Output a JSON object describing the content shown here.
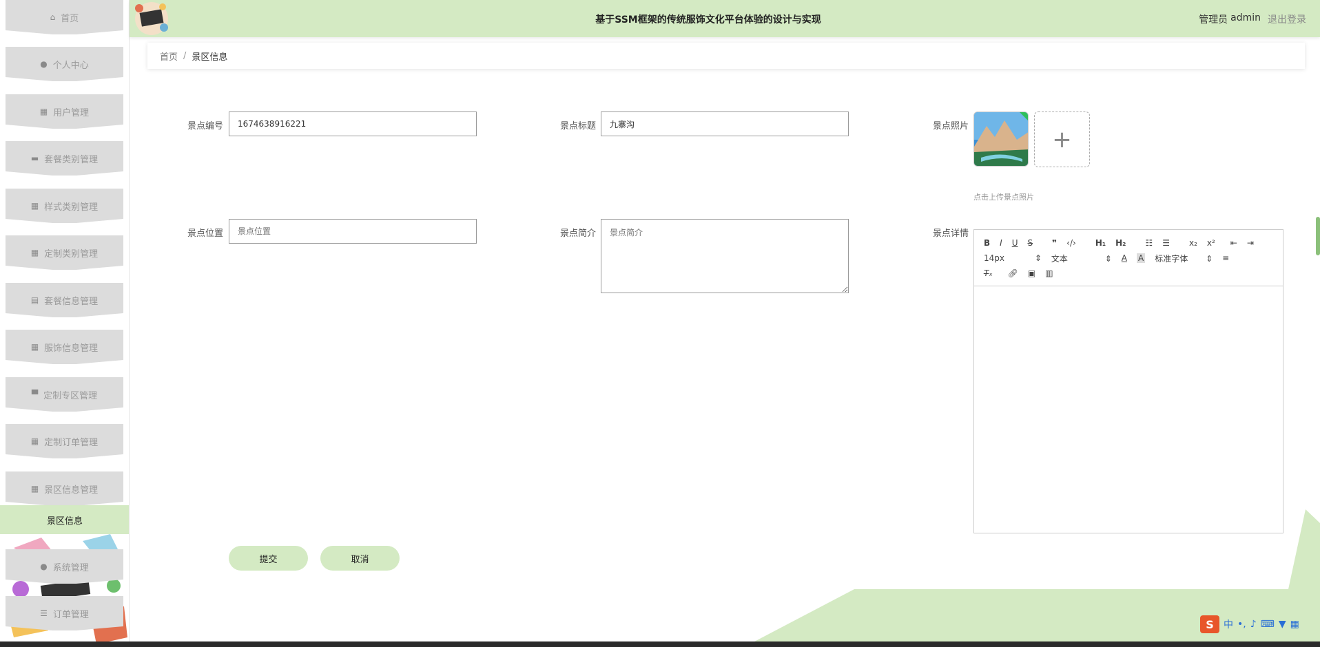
{
  "header": {
    "title": "基于SSM框架的传统服饰文化平台体验的设计与实现",
    "user_role": "管理员",
    "user_name": "admin",
    "logout": "退出登录"
  },
  "sidebar": {
    "items": [
      {
        "label": "首页",
        "icon": "home-icon"
      },
      {
        "label": "个人中心",
        "icon": "user-icon"
      },
      {
        "label": "用户管理",
        "icon": "grid-icon"
      },
      {
        "label": "套餐类别管理",
        "icon": "briefcase-icon"
      },
      {
        "label": "样式类别管理",
        "icon": "grid-icon"
      },
      {
        "label": "定制类别管理",
        "icon": "grid-icon"
      },
      {
        "label": "套餐信息管理",
        "icon": "clipboard-icon"
      },
      {
        "label": "服饰信息管理",
        "icon": "grid-icon"
      },
      {
        "label": "定制专区管理",
        "icon": "monitor-icon"
      },
      {
        "label": "定制订单管理",
        "icon": "grid-icon"
      },
      {
        "label": "景区信息管理",
        "icon": "grid-icon"
      }
    ],
    "active": "景区信息",
    "bottom_items": [
      {
        "label": "系统管理",
        "icon": "pin-icon"
      },
      {
        "label": "订单管理",
        "icon": "list-icon"
      }
    ]
  },
  "breadcrumb": {
    "home": "首页",
    "separator": "/",
    "current": "景区信息"
  },
  "form": {
    "code_label": "景点编号",
    "code_value": "1674638916221",
    "title_label": "景点标题",
    "title_value": "九寨沟",
    "photo_label": "景点照片",
    "upload_hint": "点击上传景点照片",
    "location_label": "景点位置",
    "location_placeholder": "景点位置",
    "intro_label": "景点简介",
    "intro_placeholder": "景点简介",
    "detail_label": "景点详情"
  },
  "editor": {
    "font_size": "14px",
    "text_type": "文本",
    "font_family": "标准字体"
  },
  "buttons": {
    "submit": "提交",
    "cancel": "取消"
  },
  "ime": {
    "logo": "S",
    "mode": "中"
  },
  "colors": {
    "accent": "#d4eac3",
    "sidebar_item": "#dcdcdc"
  }
}
